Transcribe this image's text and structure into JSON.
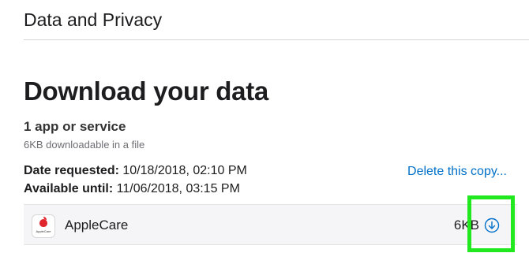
{
  "header": {
    "title": "Data and Privacy"
  },
  "section": {
    "title": "Download your data"
  },
  "summary": {
    "count": "1 app or service",
    "size": "6KB downloadable in a file"
  },
  "dates": {
    "requested_label": "Date requested:",
    "requested_value": "10/18/2018, 02:10 PM",
    "available_label": "Available until:",
    "available_value": "11/06/2018, 03:15 PM"
  },
  "actions": {
    "delete_link": "Delete this copy..."
  },
  "service": {
    "name": "AppleCare",
    "size": "6KB",
    "icon": "apple-logo-icon",
    "icon_caption": "AppleCare",
    "download_icon": "download-circle-icon"
  },
  "colors": {
    "link": "#0070c9",
    "highlight": "#22e81f",
    "row_background": "#f5f5f7"
  }
}
